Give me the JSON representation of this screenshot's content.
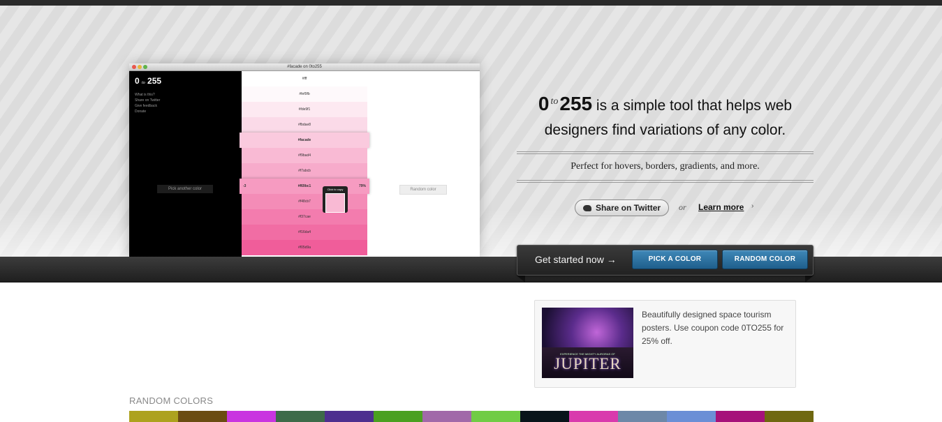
{
  "window": {
    "title": "#facade on 0to255",
    "logo": {
      "zero": "0",
      "to": "to",
      "num": "255"
    },
    "menu": [
      "What is this?",
      "Share on Twitter",
      "Give feedback",
      "Donate"
    ],
    "pick_label": "Pick another color",
    "random_label": "Random color",
    "copy_label": "Click to copy",
    "swatches": [
      {
        "hex": "#fff",
        "color": "#ffffff"
      },
      {
        "hex": "#fef9fb",
        "color": "#fef9fb"
      },
      {
        "hex": "#fde9f1",
        "color": "#fde9f1"
      },
      {
        "hex": "#fbdae8",
        "color": "#fbdae8"
      },
      {
        "hex": "#facade",
        "color": "#facade"
      },
      {
        "hex": "#f9bad4",
        "color": "#f9bad4"
      },
      {
        "hex": "#f7abcb",
        "color": "#f7abcb"
      },
      {
        "hex": "#f69bc1",
        "color": "#f69bc1",
        "left": "-3",
        "right": "79%"
      },
      {
        "hex": "#f48cb7",
        "color": "#f48cb7"
      },
      {
        "hex": "#f37cae",
        "color": "#f37cae"
      },
      {
        "hex": "#f16da4",
        "color": "#f16da4"
      },
      {
        "hex": "#f05d9a",
        "color": "#f05d9a"
      }
    ]
  },
  "headline": {
    "zero": "0",
    "to": "to",
    "num": "255",
    "rest": " is a simple tool that helps web designers find variations of any color."
  },
  "tagline": "Perfect for hovers, borders, gradients, and more.",
  "share_twitter": "Share on Twitter",
  "or": "or",
  "learn_more": "Learn more",
  "learn_chevron": "›",
  "cta": {
    "text": "Get started now →",
    "pick": "PICK A COLOR",
    "random": "RANDOM COLOR"
  },
  "ad": {
    "image_small": "EXPERIENCE THE MIGHTY AURORAS OF",
    "image_big": "JUPITER",
    "text": "Beautifully designed space tourism posters. Use coupon code 0TO255 for 25% off."
  },
  "random_colors": {
    "label": "RANDOM COLORS",
    "colors": [
      "#ada21e",
      "#6b4c12",
      "#c935e0",
      "#3d6b49",
      "#4d2f8f",
      "#4aa021",
      "#a169a9",
      "#70cc45",
      "#08141a",
      "#d93aad",
      "#6d88a8",
      "#6b8fd6",
      "#a6117a",
      "#6f6810"
    ]
  }
}
